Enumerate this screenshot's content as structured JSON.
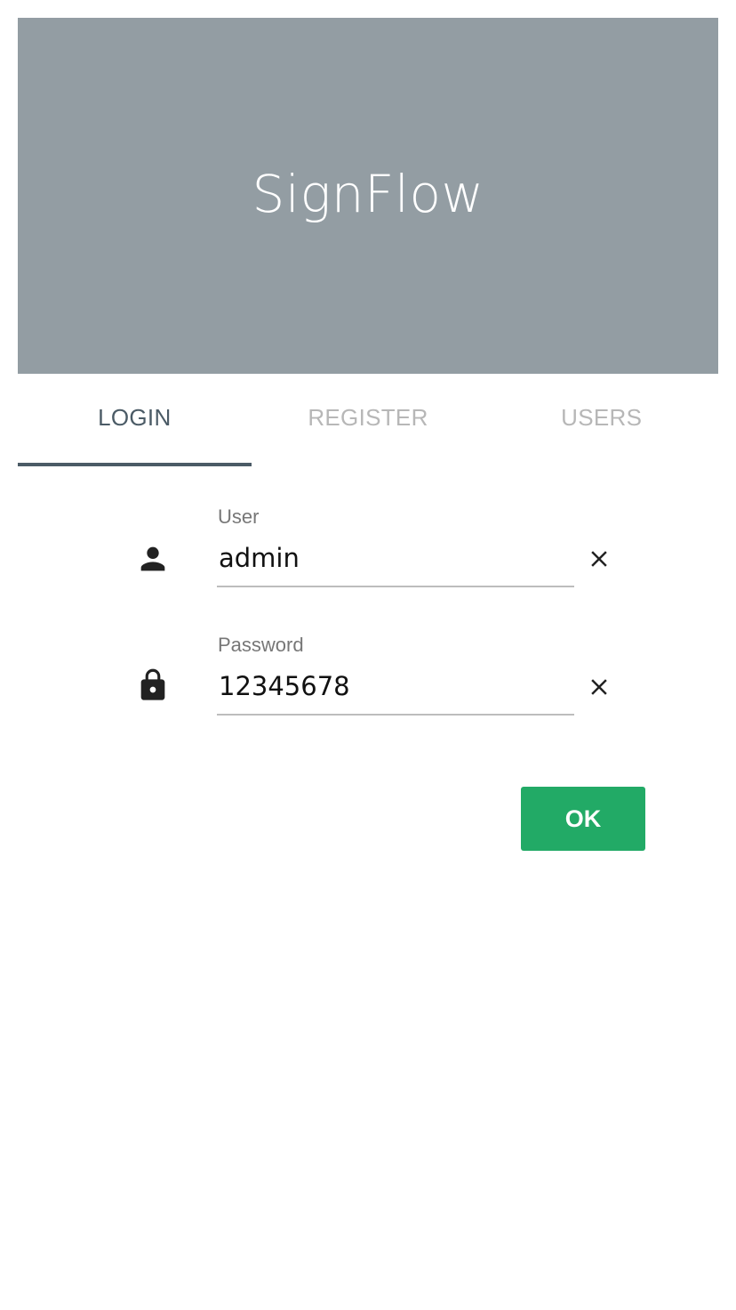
{
  "header": {
    "title": "SignFlow",
    "background_color": "#939da3"
  },
  "tabs": [
    {
      "label": "LOGIN",
      "active": true
    },
    {
      "label": "REGISTER",
      "active": false
    },
    {
      "label": "USERS",
      "active": false
    }
  ],
  "form": {
    "user": {
      "label": "User",
      "value": "admin",
      "icon": "person-icon",
      "clear_icon": "close-icon"
    },
    "password": {
      "label": "Password",
      "value": "12345678",
      "icon": "lock-icon",
      "clear_icon": "close-icon"
    },
    "submit_label": "OK"
  },
  "colors": {
    "accent": "#4b5b66",
    "ok_button": "#22aa66",
    "inactive_tab": "#b7b7b7"
  }
}
